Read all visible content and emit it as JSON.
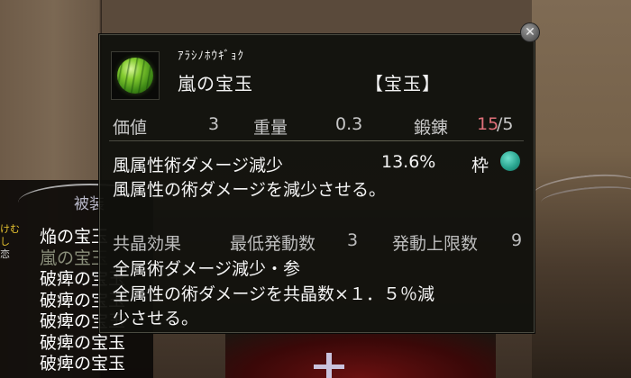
{
  "background_inventory": {
    "header": "被装",
    "side_labels": [
      "けむ",
      "し",
      "恋"
    ],
    "items": [
      "焔の宝玉",
      "嵐の宝玉",
      "破痺の宝玉",
      "破痺の宝玉",
      "破痺の宝玉",
      "破痺の宝玉",
      "破痺の宝玉"
    ]
  },
  "tooltip": {
    "close_label": "✕",
    "item": {
      "furigana": "ｱﾗｼﾉﾎｳｷﾞｮｸ",
      "name": "嵐の宝玉",
      "category": "【宝玉】",
      "icon": "green-orb-icon"
    },
    "stats": {
      "value_label": "価値",
      "value": "3",
      "weight_label": "重量",
      "weight": "0.3",
      "forge_label": "鍛錬",
      "forge_current": "15",
      "forge_max": "/5"
    },
    "effect": {
      "name": "風属性術ダメージ減少",
      "amount": "13.6%",
      "slot_label": "枠",
      "description": "風属性の術ダメージを減少させる。"
    },
    "resonance": {
      "title": "共晶効果",
      "min_label": "最低発動数",
      "min_value": "3",
      "max_label": "発動上限数",
      "max_value": "9",
      "effect_name": "全属術ダメージ減少・参",
      "description_line1": "全属性の術ダメージを共晶数×１．５％減",
      "description_line2": "少させる。"
    }
  },
  "colors": {
    "forge_highlight": "#e0707a",
    "slot_gem": "#2aa590",
    "item_orb": "#84cc30"
  }
}
